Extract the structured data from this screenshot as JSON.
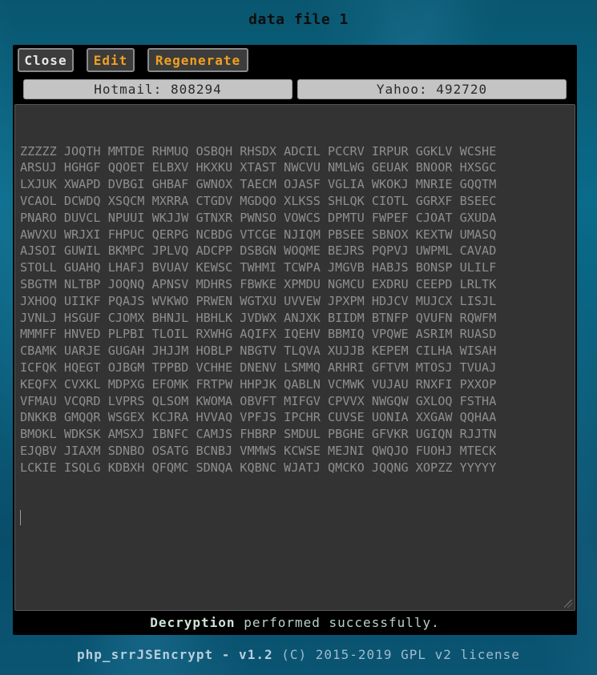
{
  "page": {
    "title": "data file 1"
  },
  "toolbar": {
    "close_label": "Close",
    "edit_label": "Edit",
    "regenerate_label": "Regenerate"
  },
  "counters": {
    "hotmail": "Hotmail: 808294",
    "yahoo": "Yahoo: 492720"
  },
  "content": {
    "lines": [
      "ZZZZZ JOQTH MMTDE RHMUQ OSBQH RHSDX ADCIL PCCRV IRPUR GGKLV WCSHE",
      "ARSUJ HGHGF QQOET ELBXV HKXKU XTAST NWCVU NMLWG GEUAK BNOOR HXSGC",
      "LXJUK XWAPD DVBGI GHBAF GWNOX TAECM OJASF VGLIA WKOKJ MNRIE GQQTM",
      "VCAOL DCWDQ XSQCM MXRRA CTGDV MGDQO XLKSS SHLQK CIOTL GGRXF BSEEC",
      "PNARO DUVCL NPUUI WKJJW GTNXR PWNSO VOWCS DPMTU FWPEF CJOAT GXUDA",
      "AWVXU WRJXI FHPUC QERPG NCBDG VTCGE NJIQM PBSEE SBNOX KEXTW UMASQ",
      "AJSOI GUWIL BKMPC JPLVQ ADCPP DSBGN WOQME BEJRS PQPVJ UWPML CAVAD",
      "STOLL GUAHQ LHAFJ BVUAV KEWSC TWHMI TCWPA JMGVB HABJS BONSP ULILF",
      "SBGTM NLTBP JOQNQ APNSV MDHRS FBWKE XPMDU NGMCU EXDRU CEEPD LRLTK",
      "JXHOQ UIIKF PQAJS WVKWO PRWEN WGTXU UVVEW JPXPM HDJCV MUJCX LISJL",
      "JVNLJ HSGUF CJOMX BHNJL HBHLK JVDWX ANJXK BIIDM BTNFP QVUFN RQWFM",
      "MMMFF HNVED PLPBI TLOIL RXWHG AQIFX IQEHV BBMIQ VPQWE ASRIM RUASD",
      "CBAMK UARJE GUGAH JHJJM HOBLP NBGTV TLQVA XUJJB KEPEM CILHA WISAH",
      "ICFQK HQEGT OJBGM TPPBD VCHHE DNENV LSMMQ ARHRI GFTVM MTOSJ TVUAJ",
      "KEQFX CVXKL MDPXG EFOMK FRTPW HHPJK QABLN VCMWK VUJAU RNXFI PXXOP",
      "VFMAU VCQRD LVPRS QLSOM KWOMA OBVFT MIFGV CPVVX NWGQW GXLOQ FSTHA",
      "DNKKB GMQQR WSGEX KCJRA HVVAQ VPFJS IPCHR CUVSE UONIA XXGAW QQHAA",
      "BMOKL WDKSK AMSXJ IBNFC CAMJS FHBRP SMDUL PBGHE GFVKR UGIQN RJJTN",
      "EJQBV JIAXM SDNBO OSATG BCNBJ VMMWS KCWSE MEJNI QWQJO FUOHJ MTECK",
      "LCKIE ISQLG KDBXH QFQMC SDNQA KQBNC WJATJ QMCKO JQQNG XOPZZ YYYYY"
    ]
  },
  "status": {
    "strong": "Decryption",
    "rest": " performed successfully."
  },
  "footer": {
    "strong": "php_srrJSEncrypt - v1.2",
    "rest": " (C) 2015-2019 GPL v2 license"
  }
}
